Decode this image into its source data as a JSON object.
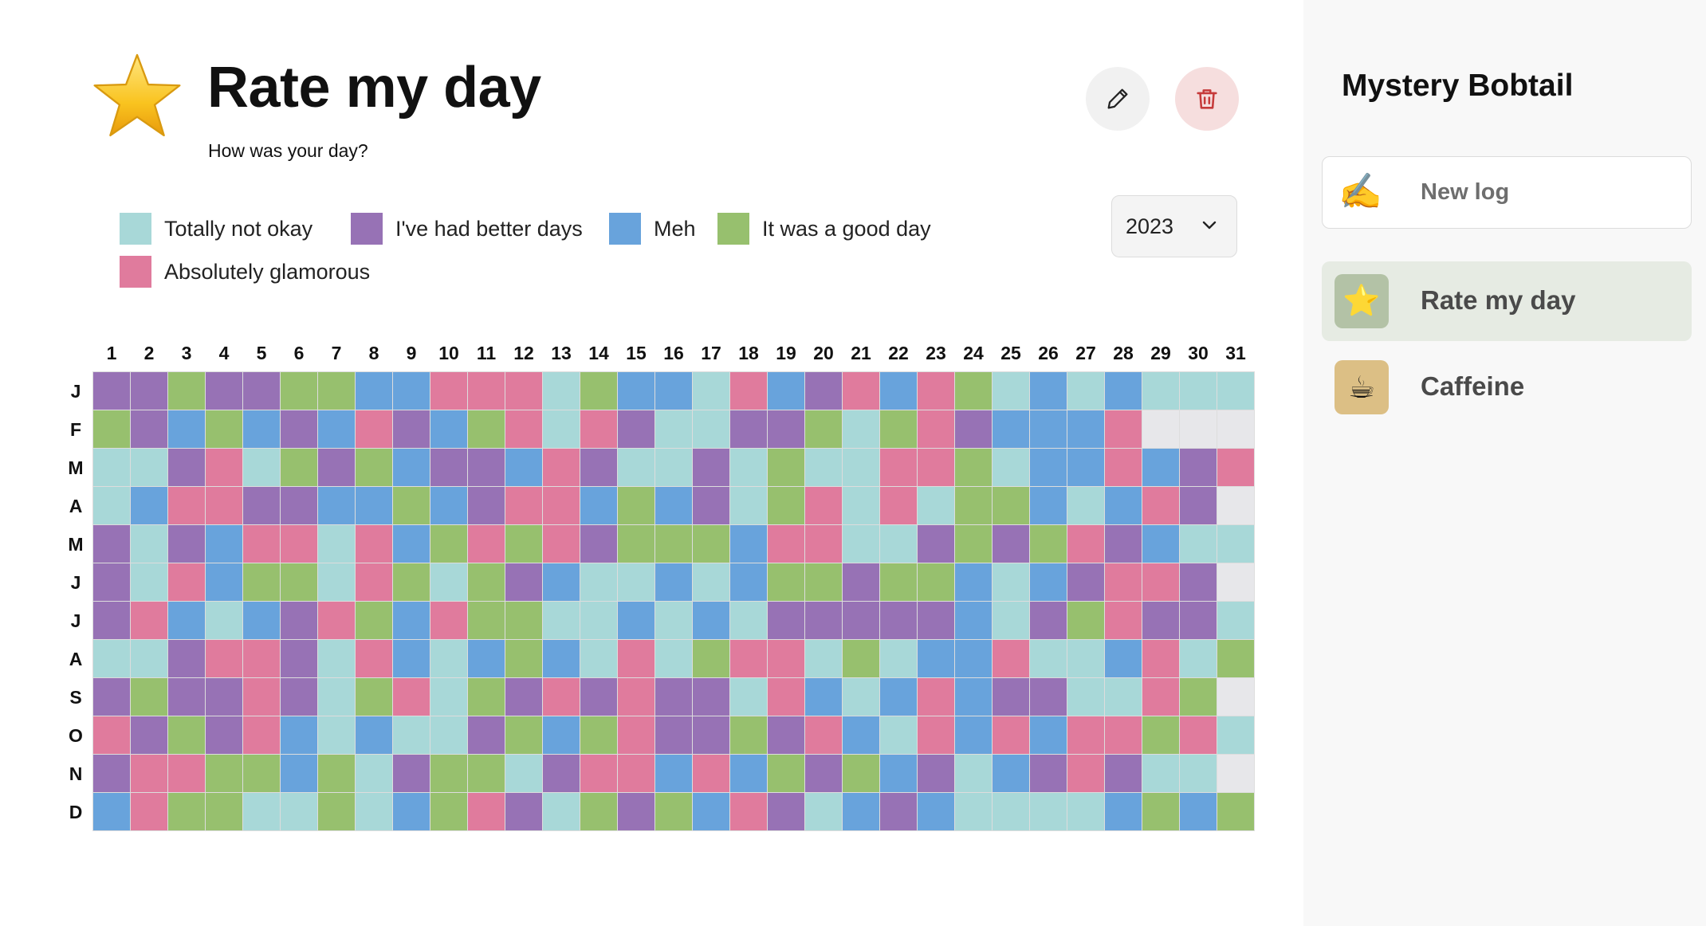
{
  "log": {
    "title": "Rate my day",
    "subtitle": "How was your day?",
    "icon": "star-icon",
    "edit_icon": "pencil-icon",
    "delete_icon": "trash-icon"
  },
  "legend": [
    {
      "label": "Totally not okay",
      "color": "#a8d8d8"
    },
    {
      "label": "I've had better days",
      "color": "#9772b5"
    },
    {
      "label": "Meh",
      "color": "#68a3dc"
    },
    {
      "label": "It was a good day",
      "color": "#97c06e"
    },
    {
      "label": "Absolutely glamorous",
      "color": "#e07b9d"
    }
  ],
  "empty_color": "#e7e7ea",
  "year_select": {
    "value": "2023",
    "icon": "chevron-down-icon"
  },
  "days": [
    "1",
    "2",
    "3",
    "4",
    "5",
    "6",
    "7",
    "8",
    "9",
    "10",
    "11",
    "12",
    "13",
    "14",
    "15",
    "16",
    "17",
    "18",
    "19",
    "20",
    "21",
    "22",
    "23",
    "24",
    "25",
    "26",
    "27",
    "28",
    "29",
    "30",
    "31"
  ],
  "months": [
    "J",
    "F",
    "M",
    "A",
    "M",
    "J",
    "J",
    "A",
    "S",
    "O",
    "N",
    "D"
  ],
  "ratings": [
    [
      2,
      2,
      4,
      2,
      2,
      4,
      4,
      3,
      3,
      5,
      5,
      5,
      1,
      4,
      3,
      3,
      1,
      5,
      3,
      2,
      5,
      3,
      5,
      4,
      1,
      3,
      1,
      3,
      1,
      1,
      1
    ],
    [
      4,
      2,
      3,
      4,
      3,
      2,
      3,
      5,
      2,
      3,
      4,
      5,
      1,
      5,
      2,
      1,
      1,
      2,
      2,
      4,
      1,
      4,
      5,
      2,
      3,
      3,
      3,
      5,
      0,
      0,
      0
    ],
    [
      1,
      1,
      2,
      5,
      1,
      4,
      2,
      4,
      3,
      2,
      2,
      3,
      5,
      2,
      1,
      1,
      2,
      1,
      4,
      1,
      1,
      5,
      5,
      4,
      1,
      3,
      3,
      5,
      3,
      2,
      5
    ],
    [
      1,
      3,
      5,
      5,
      2,
      2,
      3,
      3,
      4,
      3,
      2,
      5,
      5,
      3,
      4,
      3,
      2,
      1,
      4,
      5,
      1,
      5,
      1,
      4,
      4,
      3,
      1,
      3,
      5,
      2,
      0
    ],
    [
      2,
      1,
      2,
      3,
      5,
      5,
      1,
      5,
      3,
      4,
      5,
      4,
      5,
      2,
      4,
      4,
      4,
      3,
      5,
      5,
      1,
      1,
      2,
      4,
      2,
      4,
      5,
      2,
      3,
      1,
      1
    ],
    [
      2,
      1,
      5,
      3,
      4,
      4,
      1,
      5,
      4,
      1,
      4,
      2,
      3,
      1,
      1,
      3,
      1,
      3,
      4,
      4,
      2,
      4,
      4,
      3,
      1,
      3,
      2,
      5,
      5,
      2,
      0
    ],
    [
      2,
      5,
      3,
      1,
      3,
      2,
      5,
      4,
      3,
      5,
      4,
      4,
      1,
      1,
      3,
      1,
      3,
      1,
      2,
      2,
      2,
      2,
      2,
      3,
      1,
      2,
      4,
      5,
      2,
      2,
      1
    ],
    [
      1,
      1,
      2,
      5,
      5,
      2,
      1,
      5,
      3,
      1,
      3,
      4,
      3,
      1,
      5,
      1,
      4,
      5,
      5,
      1,
      4,
      1,
      3,
      3,
      5,
      1,
      1,
      3,
      5,
      1,
      4
    ],
    [
      2,
      4,
      2,
      2,
      5,
      2,
      1,
      4,
      5,
      1,
      4,
      2,
      5,
      2,
      5,
      2,
      2,
      1,
      5,
      3,
      1,
      3,
      5,
      3,
      2,
      2,
      1,
      1,
      5,
      4,
      0
    ],
    [
      5,
      2,
      4,
      2,
      5,
      3,
      1,
      3,
      1,
      1,
      2,
      4,
      3,
      4,
      5,
      2,
      2,
      4,
      2,
      5,
      3,
      1,
      5,
      3,
      5,
      3,
      5,
      5,
      4,
      5,
      1
    ],
    [
      2,
      5,
      5,
      4,
      4,
      3,
      4,
      1,
      2,
      4,
      4,
      1,
      2,
      5,
      5,
      3,
      5,
      3,
      4,
      2,
      4,
      3,
      2,
      1,
      3,
      2,
      5,
      2,
      1,
      1,
      0
    ],
    [
      3,
      5,
      4,
      4,
      1,
      1,
      4,
      1,
      3,
      4,
      5,
      2,
      1,
      4,
      2,
      4,
      3,
      5,
      2,
      1,
      3,
      2,
      3,
      1,
      1,
      1,
      1,
      3,
      4,
      3,
      4
    ]
  ],
  "user": {
    "name": "Mystery Bobtail"
  },
  "new_log": {
    "label": "New log",
    "icon": "writing-hand-icon"
  },
  "nav": [
    {
      "label": "Rate my day",
      "icon": "star-icon",
      "icon_bg": "#b3c2a6",
      "active": true
    },
    {
      "label": "Caffeine",
      "icon": "coffee-icon",
      "icon_bg": "#dcbf85",
      "active": false
    }
  ]
}
